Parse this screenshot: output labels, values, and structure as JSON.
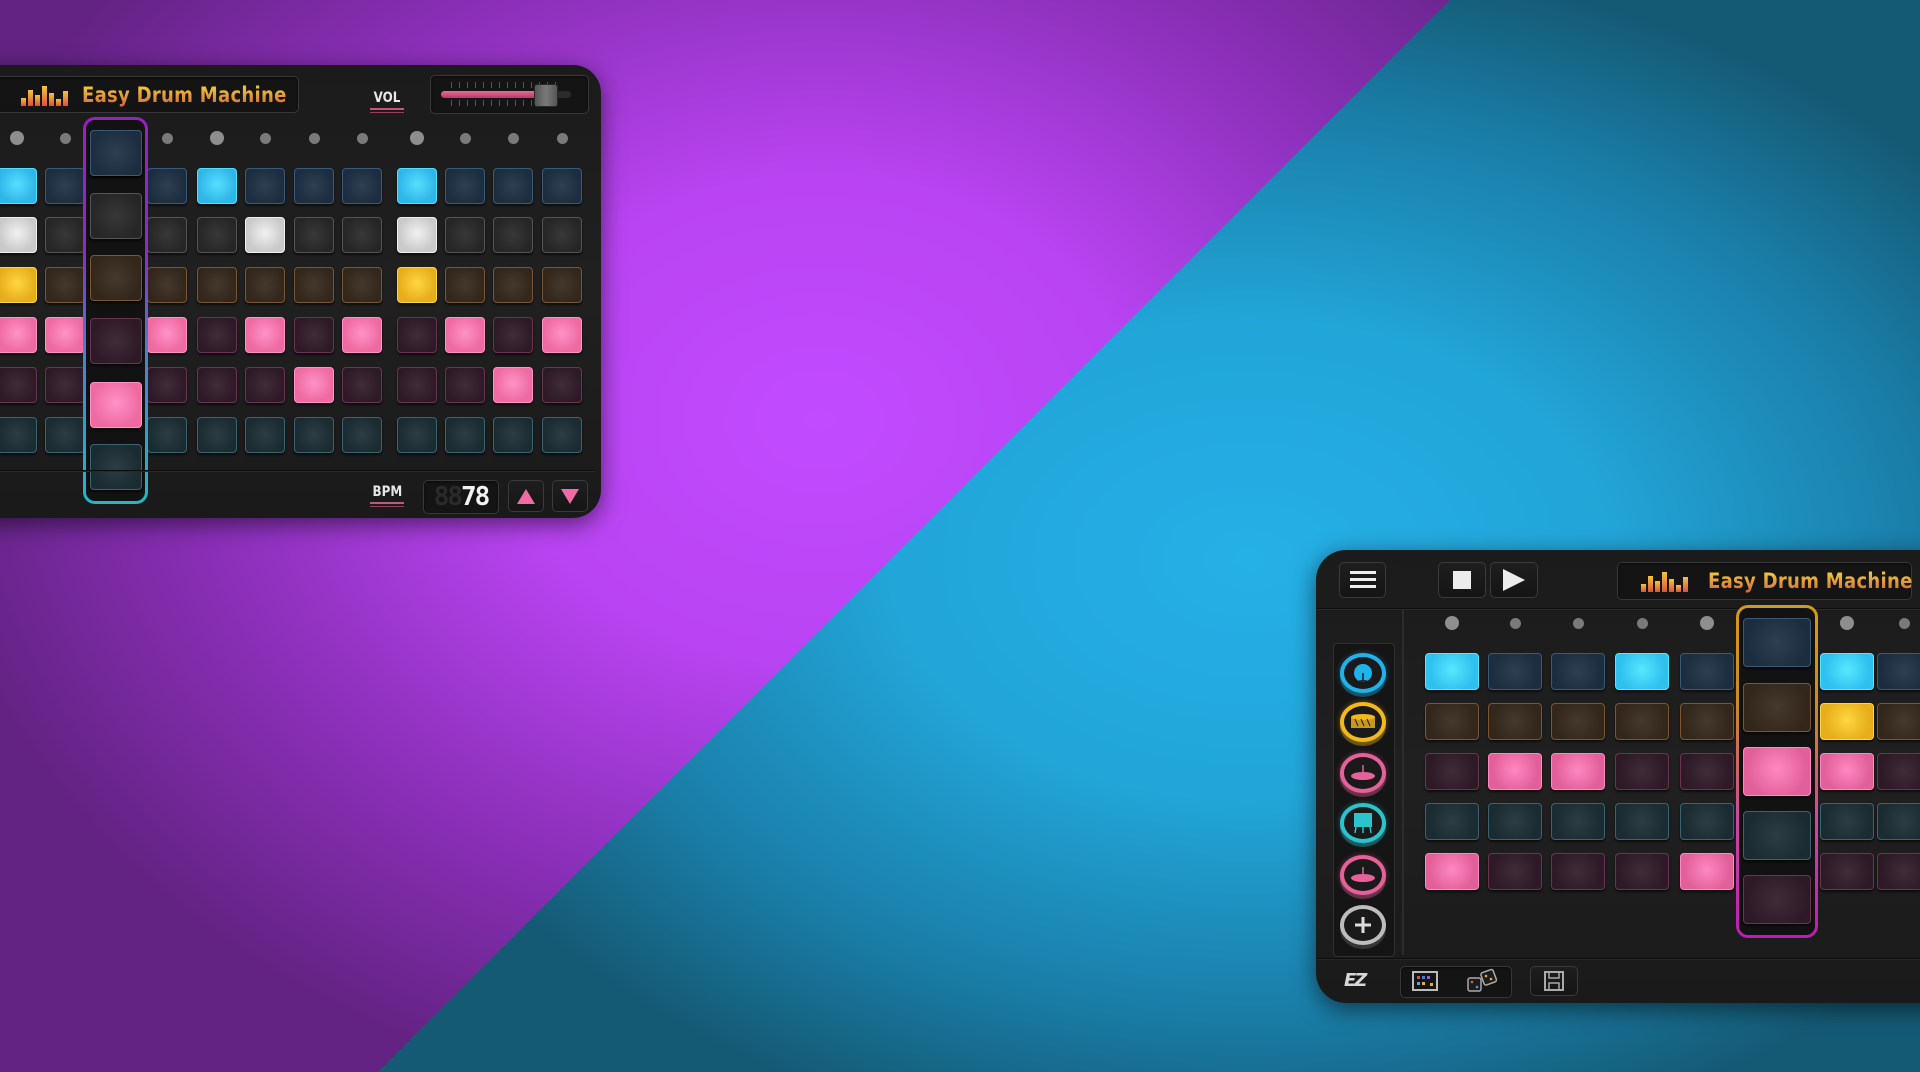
{
  "app_title": "Easy Drum Machine",
  "colors": {
    "bg_purple": "#bf48fb",
    "bg_cyan": "#23ace3",
    "title_gradient_top": "#f0c23a",
    "title_gradient_bottom": "#d36a3c",
    "accent_pink": "#f06aa8",
    "slider_fill": "#d4507e"
  },
  "left_panel": {
    "title": "Easy Drum Machine",
    "vol_label": "VOL",
    "volume": 0.8,
    "bpm_label": "BPM",
    "bpm_ghost": "88",
    "bpm_value": "78",
    "bpm_up_icon": "triangle-up-icon",
    "bpm_down_icon": "triangle-down-icon",
    "current_step": 2,
    "steps": 12,
    "tracks": [
      {
        "name": "track-1",
        "color_on": "#2fb6e8",
        "color_off": "#1c2d40",
        "border_off": "#3a5a78",
        "steps": [
          1,
          0,
          0,
          0,
          1,
          0,
          0,
          0,
          1,
          0,
          0,
          0
        ]
      },
      {
        "name": "track-2",
        "color_on": "#c9c9c9",
        "color_off": "#262626",
        "border_off": "#555555",
        "steps": [
          1,
          0,
          0,
          0,
          0,
          1,
          0,
          0,
          1,
          0,
          0,
          0
        ]
      },
      {
        "name": "track-3",
        "color_on": "#e6ae1a",
        "color_off": "#33261a",
        "border_off": "#7a5632",
        "steps": [
          1,
          0,
          0,
          0,
          0,
          0,
          0,
          0,
          1,
          0,
          0,
          0
        ]
      },
      {
        "name": "track-4",
        "color_on": "#ee6aa0",
        "color_off": "#2e1a26",
        "border_off": "#6a3550",
        "steps": [
          1,
          1,
          0,
          1,
          0,
          1,
          0,
          1,
          0,
          1,
          0,
          1
        ]
      },
      {
        "name": "track-5",
        "color_on": "#ee6aa0",
        "color_off": "#2e1a26",
        "border_off": "#6a3550",
        "steps": [
          0,
          0,
          1,
          0,
          0,
          0,
          1,
          0,
          0,
          0,
          1,
          0
        ]
      },
      {
        "name": "track-6",
        "color_on": "#2fa8b8",
        "color_off": "#1a2c32",
        "border_off": "#3b6470",
        "steps": [
          0,
          0,
          0,
          0,
          0,
          0,
          0,
          0,
          0,
          0,
          0,
          0
        ]
      }
    ]
  },
  "right_panel": {
    "title": "Easy Drum Machine",
    "menu_icon": "hamburger-menu-icon",
    "stop_icon": "stop-icon",
    "play_icon": "play-icon",
    "current_step": 5,
    "instruments": [
      {
        "name": "kick-drum",
        "icon": "kick-drum-icon",
        "color": "#1fb3ec"
      },
      {
        "name": "snare-drum",
        "icon": "snare-drum-icon",
        "color": "#f2b81c"
      },
      {
        "name": "hi-hat",
        "icon": "cymbal-icon",
        "color": "#e6609a"
      },
      {
        "name": "floor-tom",
        "icon": "floor-tom-icon",
        "color": "#2bc4cc"
      },
      {
        "name": "crash",
        "icon": "cymbal-icon",
        "color": "#e6609a"
      }
    ],
    "add_instrument_icon": "add-icon",
    "tracks": [
      {
        "color_on": "#2fc0ef",
        "color_off": "#1c2d40",
        "border_off": "#3a5a78",
        "steps": [
          1,
          0,
          0,
          1,
          0,
          0,
          1,
          0
        ]
      },
      {
        "color_on": "#e6ae1a",
        "color_off": "#33261a",
        "border_off": "#7a5632",
        "steps": [
          0,
          0,
          0,
          0,
          0,
          0,
          1,
          0
        ]
      },
      {
        "color_on": "#e2609a",
        "color_off": "#2e1a26",
        "border_off": "#6a3550",
        "steps": [
          0,
          1,
          1,
          0,
          0,
          1,
          1,
          0
        ]
      },
      {
        "color_on": "#2fa8b8",
        "color_off": "#1a2c32",
        "border_off": "#3b6470",
        "steps": [
          0,
          0,
          0,
          0,
          0,
          0,
          0,
          0
        ]
      },
      {
        "color_on": "#e2609a",
        "color_off": "#2e1a26",
        "border_off": "#6a3550",
        "steps": [
          1,
          0,
          0,
          0,
          1,
          0,
          0,
          0
        ]
      }
    ],
    "footer": {
      "logo": "EZ",
      "pattern_icon": "pattern-grid-icon",
      "random_icon": "dice-icon",
      "save_icon": "save-icon"
    }
  }
}
